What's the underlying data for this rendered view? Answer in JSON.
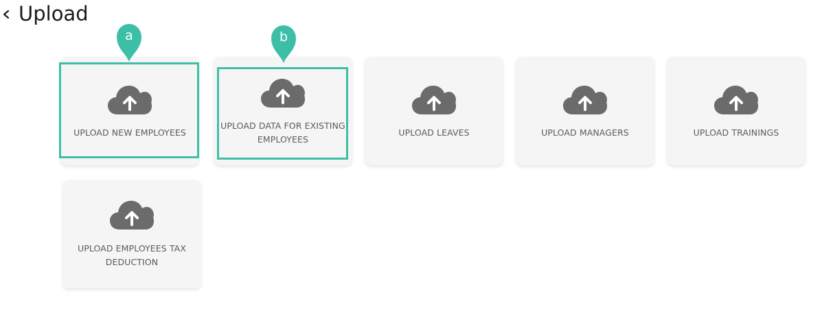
{
  "header": {
    "back_icon": "chevron-left-icon",
    "title": "Upload"
  },
  "cards": [
    {
      "label": "UPLOAD NEW EMPLOYEES",
      "icon": "cloud-upload-icon"
    },
    {
      "label": "UPLOAD DATA FOR EXISTING EMPLOYEES",
      "icon": "cloud-upload-icon"
    },
    {
      "label": "UPLOAD LEAVES",
      "icon": "cloud-upload-icon"
    },
    {
      "label": "UPLOAD MANAGERS",
      "icon": "cloud-upload-icon"
    },
    {
      "label": "UPLOAD TRAININGS",
      "icon": "cloud-upload-icon"
    },
    {
      "label": "UPLOAD EMPLOYEES TAX DEDUCTION",
      "icon": "cloud-upload-icon"
    }
  ],
  "annotations": [
    {
      "letter": "a"
    },
    {
      "letter": "b"
    }
  ],
  "colors": {
    "accent": "#3dbfa7",
    "card_bg": "#f5f5f5",
    "icon": "#6b6b6b",
    "label": "#5a5a5a"
  }
}
